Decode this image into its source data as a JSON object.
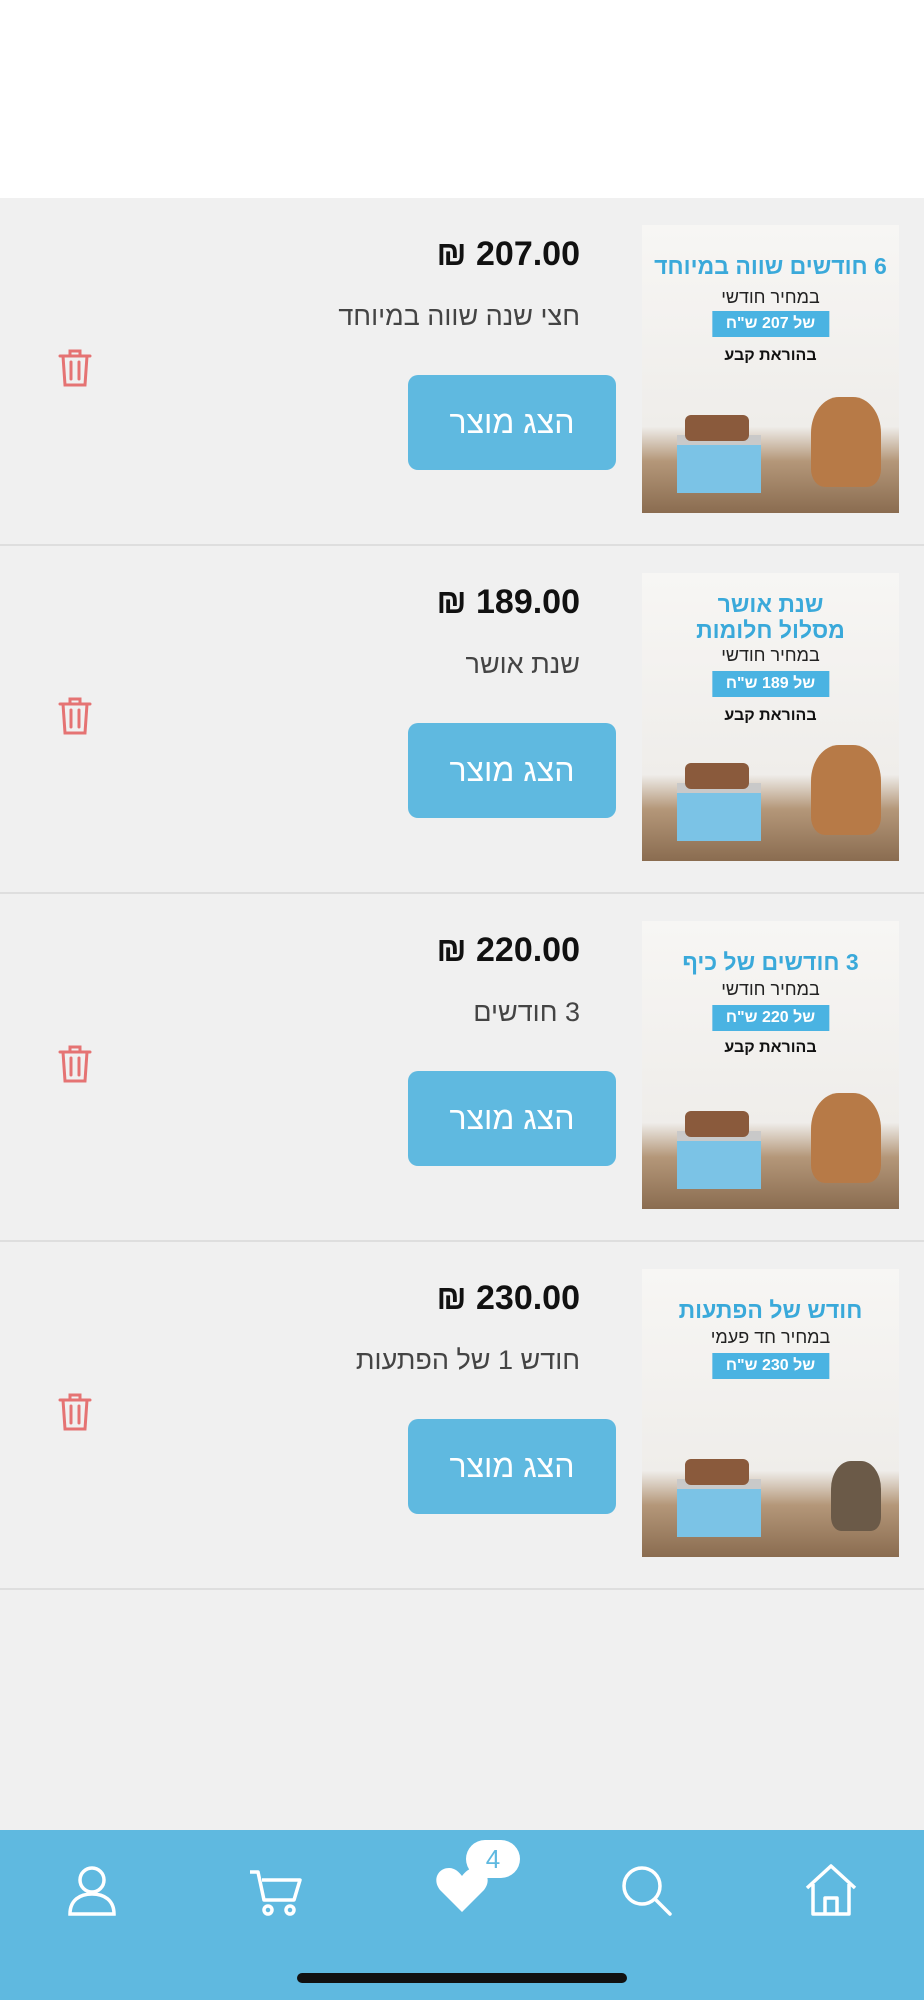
{
  "products": [
    {
      "price": "₪ 207.00",
      "name": "חצי שנה שווה במיוחד",
      "button_label": "הצג מוצר",
      "image": {
        "headline": "6 חודשים שווה במיוחד",
        "subline": "במחיר חודשי",
        "price_tag": "של 207 ש\"ח",
        "footer": "בהוראת קבע"
      }
    },
    {
      "price": "₪ 189.00",
      "name": "שנת אושר",
      "button_label": "הצג מוצר",
      "image": {
        "headline": "שנת אושר מסלול חלומות",
        "subline": "במחיר חודשי",
        "price_tag": "של 189 ש\"ח",
        "footer": "בהוראת קבע"
      }
    },
    {
      "price": "₪ 220.00",
      "name": "3 חודשים",
      "button_label": "הצג מוצר",
      "image": {
        "headline": "3 חודשים של כיף",
        "subline": "במחיר חודשי",
        "price_tag": "של 220 ש\"ח",
        "footer": "בהוראת קבע"
      }
    },
    {
      "price": "₪ 230.00",
      "name": "חודש 1 של הפתעות",
      "button_label": "הצג מוצר",
      "image": {
        "headline": "חודש של הפתעות",
        "subline": "במחיר חד פעמי",
        "price_tag": "של 230 ש\"ח",
        "footer": ""
      }
    }
  ],
  "bottom_nav": {
    "items": [
      "profile-icon",
      "cart-icon",
      "heart-icon",
      "search-icon",
      "home-icon"
    ],
    "wishlist_count": "4"
  },
  "colors": {
    "accent": "#5fb9e0",
    "trash": "#e57373",
    "background": "#f0f0f0"
  }
}
